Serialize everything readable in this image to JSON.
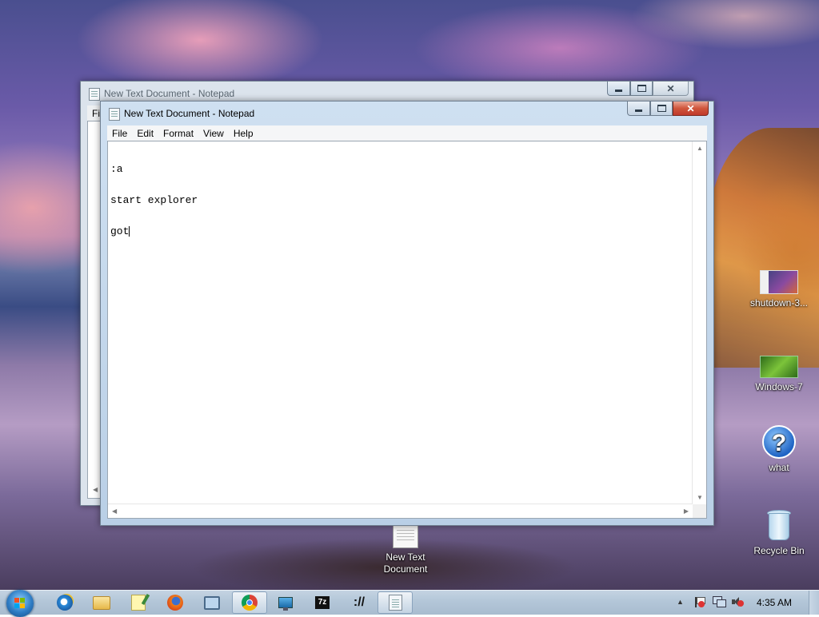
{
  "desktop": {
    "icons": [
      {
        "label": "shutdown-3...",
        "icon": "shortcut-image-icon"
      },
      {
        "label": "Windows-7",
        "icon": "windows7-image-icon"
      },
      {
        "label": "what",
        "icon": "help-question-icon"
      },
      {
        "label": "Recycle Bin",
        "icon": "recycle-bin-icon"
      },
      {
        "label": "New Text Document",
        "label_line1": "New Text",
        "label_line2": "Document",
        "icon": "text-document-icon"
      }
    ]
  },
  "back_window": {
    "title": "New Text Document - Notepad",
    "menu_fragment": "Fi"
  },
  "front_window": {
    "title": "New Text Document - Notepad",
    "menu": [
      "File",
      "Edit",
      "Format",
      "View",
      "Help"
    ],
    "content_lines": [
      ":a",
      "start explorer",
      "got"
    ]
  },
  "taskbar": {
    "apps": [
      {
        "name": "Internet Explorer",
        "icon": "ie-icon"
      },
      {
        "name": "Windows Explorer",
        "icon": "folder-icon"
      },
      {
        "name": "Sticky Notes",
        "icon": "notepad-pencil-icon"
      },
      {
        "name": "Firefox",
        "icon": "firefox-icon"
      },
      {
        "name": "Network",
        "icon": "network-icon"
      },
      {
        "name": "Chrome",
        "icon": "chrome-icon"
      },
      {
        "name": "Remote Desktop",
        "icon": "monitor-icon"
      },
      {
        "name": "7-Zip",
        "icon": "7zip-icon",
        "text": "7z"
      },
      {
        "name": "Shell",
        "icon": "shell-icon",
        "text": "://"
      },
      {
        "name": "Notepad",
        "icon": "notepad-icon"
      }
    ],
    "clock": "4:35 AM"
  },
  "colors": {
    "close_red": "#c0392b",
    "taskbar": "#b3c6d8"
  }
}
